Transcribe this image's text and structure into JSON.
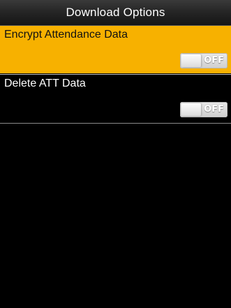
{
  "title_bar": {
    "title": "Download Options"
  },
  "options": [
    {
      "label": "Encrypt Attendance Data",
      "toggle_state": "OFF",
      "selected": true
    },
    {
      "label": "Delete ATT Data",
      "toggle_state": "OFF",
      "selected": false
    }
  ],
  "colors": {
    "selected_row": "#f7b100",
    "background": "#000000",
    "title_text": "#ffffff"
  }
}
